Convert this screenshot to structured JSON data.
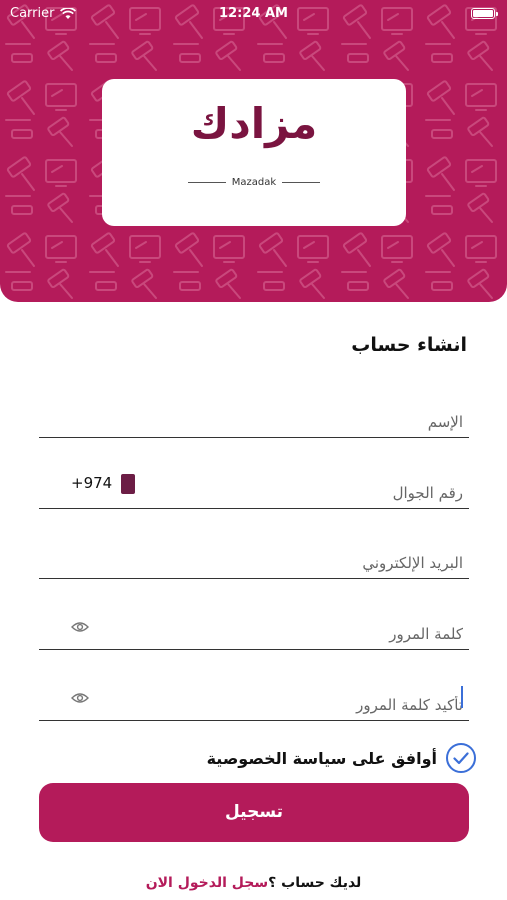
{
  "status_bar": {
    "carrier": "Carrier",
    "time": "12:24 AM"
  },
  "logo": {
    "arabic": "مزادك",
    "latin": "Mazadak"
  },
  "form": {
    "title": "انشاء حساب",
    "name_placeholder": "الإسم",
    "phone_placeholder": "رقم الجوال",
    "phone_code": "+974",
    "email_placeholder": "البريد الإلكتروني",
    "password_placeholder": "كلمة المرور",
    "confirm_password_placeholder": "تأكيد كلمة المرور"
  },
  "agree": {
    "label": "أوافق على سياسة الخصوصية",
    "checked": true
  },
  "register_button": "تسجيل",
  "login_prompt": {
    "question": "لديك حساب ؟",
    "link": "سجل الدخول الان"
  },
  "colors": {
    "brand": "#b41b5a",
    "logo_text": "#7a1440",
    "check_blue": "#3b6fd8"
  },
  "icons": [
    "wifi-icon",
    "battery-icon",
    "gavel-pattern",
    "flag-icon",
    "eye-icon",
    "check-circle-icon"
  ]
}
